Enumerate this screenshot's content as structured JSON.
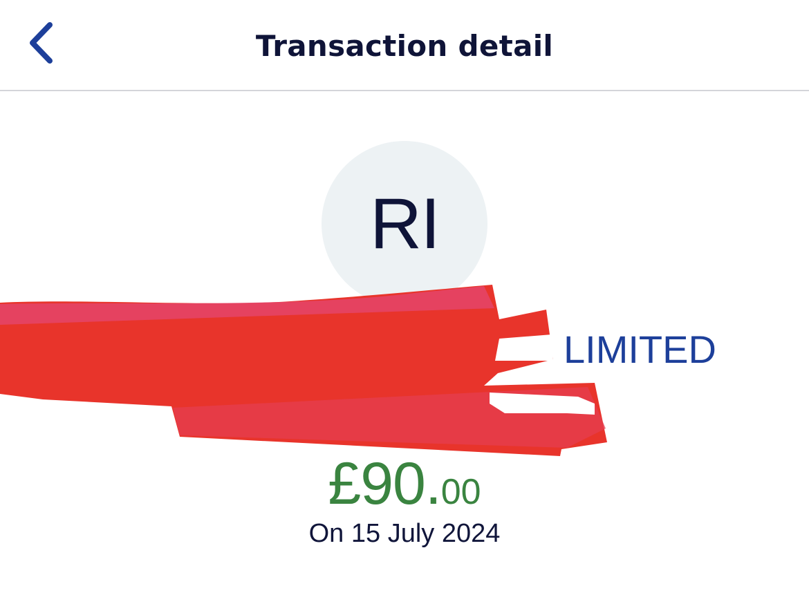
{
  "header": {
    "title": "Transaction detail",
    "back_icon": "chevron-left-icon"
  },
  "merchant": {
    "initials": "RI",
    "name_visible": "LIMITED"
  },
  "transaction": {
    "amount_major": "£90.",
    "amount_minor": "00",
    "date": "On 15 July 2024"
  },
  "colors": {
    "accent_blue": "#1d3f9a",
    "amount_green": "#3a8440",
    "title_navy": "#0f1438",
    "avatar_bg": "#edf2f4",
    "redaction_red": "#e8342b"
  }
}
